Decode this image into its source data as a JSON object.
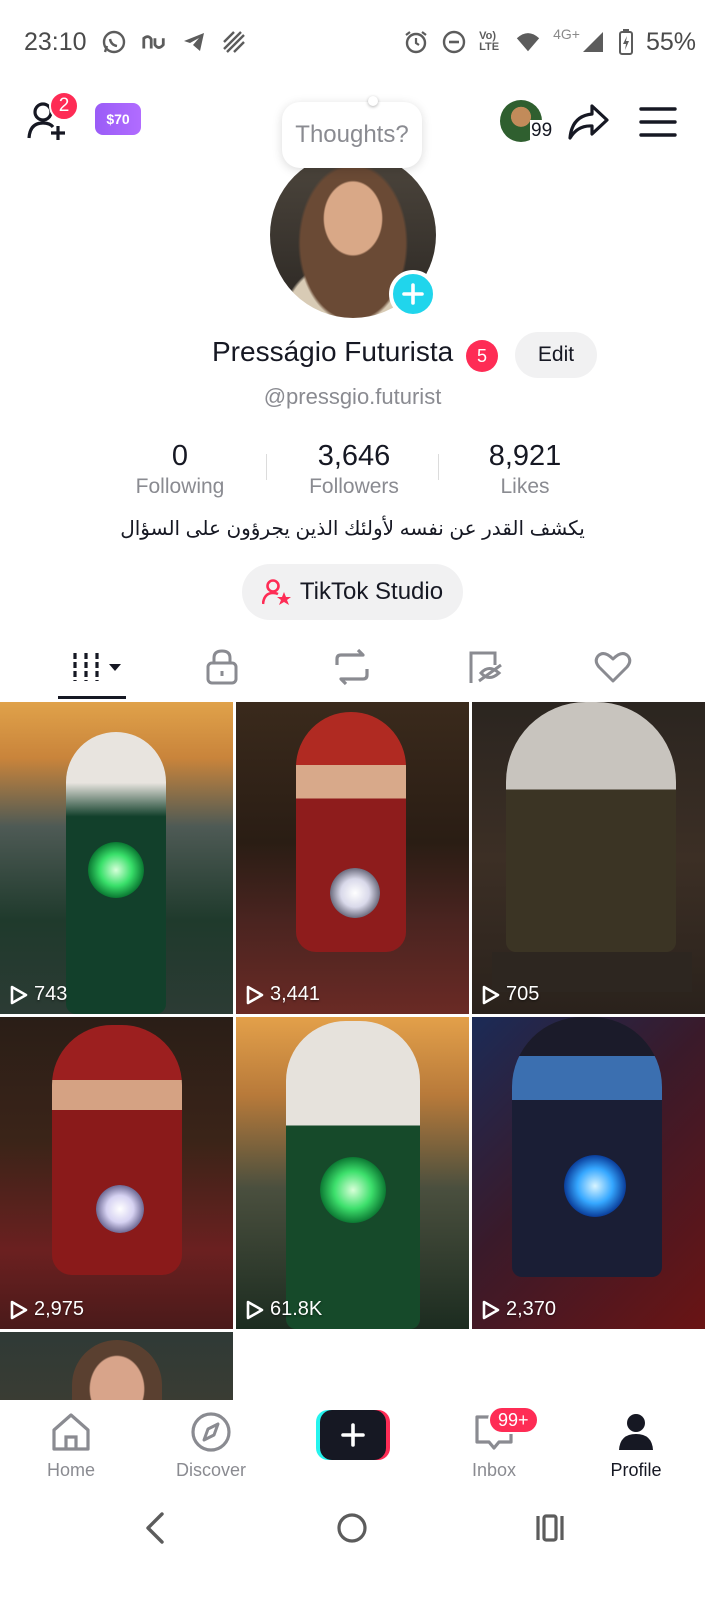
{
  "status_bar": {
    "time": "23:10",
    "network_text": "Vo) LTE",
    "network_type": "4G+",
    "battery": "55%",
    "left_icons": [
      "whatsapp-icon",
      "nu-icon",
      "telegram-icon",
      "striped-icon"
    ],
    "right_icons": [
      "alarm-icon",
      "dnd-icon",
      "volte-icon",
      "wifi-icon",
      "signal-icon",
      "battery-icon"
    ]
  },
  "header": {
    "add_friends_badge": "2",
    "coins_label": "$70",
    "thoughts_placeholder": "Thoughts?",
    "mini_avatar_count": "99"
  },
  "profile": {
    "display_name": "Presságio Futurista",
    "name_badge": "5",
    "edit_label": "Edit",
    "handle": "@pressgio.futurist",
    "bio": "يكشف القدر عن نفسه لأولئك الذين يجرؤون على السؤال",
    "studio_label": "TikTok Studio"
  },
  "stats": {
    "following_count": "0",
    "following_label": "Following",
    "followers_count": "3,646",
    "followers_label": "Followers",
    "likes_count": "8,921",
    "likes_label": "Likes"
  },
  "tabs": [
    "videos-grid-icon",
    "private-lock-icon",
    "reposts-icon",
    "favorites-icon",
    "liked-heart-icon"
  ],
  "videos": [
    {
      "views": "743"
    },
    {
      "views": "3,441"
    },
    {
      "views": "705"
    },
    {
      "views": "2,975"
    },
    {
      "views": "61.8K"
    },
    {
      "views": "2,370"
    }
  ],
  "bottom_nav": {
    "home": "Home",
    "discover": "Discover",
    "inbox": "Inbox",
    "inbox_badge": "99+",
    "profile": "Profile"
  },
  "colors": {
    "accent": "#fe2c55",
    "cyan": "#20d5ec",
    "text": "#161823",
    "muted": "#8a8b91"
  }
}
